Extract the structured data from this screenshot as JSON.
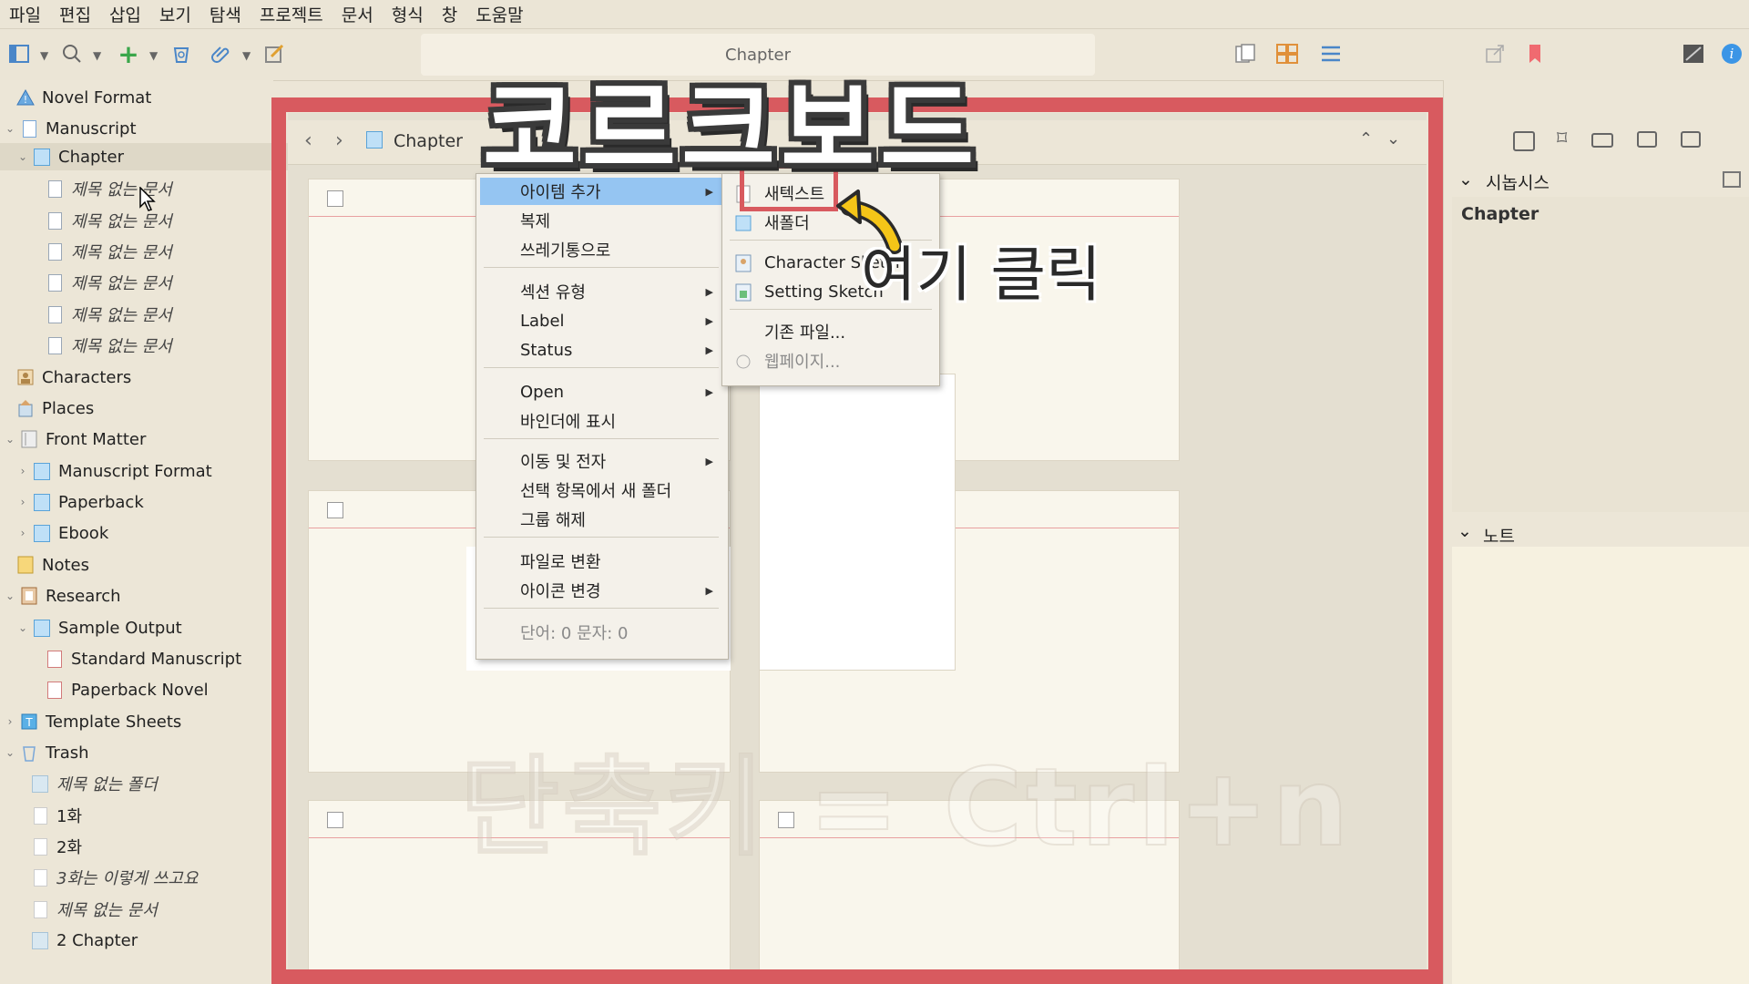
{
  "menubar": [
    "파일",
    "편집",
    "삽입",
    "보기",
    "탐색",
    "프로젝트",
    "문서",
    "형식",
    "창",
    "도움말"
  ],
  "toolbar": {
    "doc_title": "Chapter",
    "icons": [
      "binder-icon",
      "search-icon",
      "add-icon",
      "trash-icon",
      "attach-icon",
      "compose-icon",
      "single-view-icon",
      "corkboard-icon",
      "outline-icon",
      "share-icon",
      "bookmark-icon",
      "compose-mode-icon",
      "info-icon"
    ]
  },
  "binder": {
    "items": [
      {
        "label": "Novel Format",
        "level": 0,
        "icon": "warning-icon"
      },
      {
        "label": "Manuscript",
        "level": 0,
        "icon": "document-icon"
      },
      {
        "label": "Chapter",
        "level": 1,
        "icon": "folder-icon"
      },
      {
        "label": "제목 없는 문서",
        "level": 2,
        "icon": "document-icon"
      },
      {
        "label": "제목 없는 문서",
        "level": 2,
        "icon": "document-icon"
      },
      {
        "label": "제목 없는 문서",
        "level": 2,
        "icon": "document-icon"
      },
      {
        "label": "제목 없는 문서",
        "level": 2,
        "icon": "document-icon"
      },
      {
        "label": "제목 없는 문서",
        "level": 2,
        "icon": "document-icon"
      },
      {
        "label": "제목 없는 문서",
        "level": 2,
        "icon": "document-icon"
      },
      {
        "label": "Characters",
        "level": 0,
        "icon": "characters-icon"
      },
      {
        "label": "Places",
        "level": 0,
        "icon": "places-icon"
      },
      {
        "label": "Front Matter",
        "level": 0,
        "icon": "front-matter-icon"
      },
      {
        "label": "Manuscript Format",
        "level": 1,
        "icon": "folder-icon"
      },
      {
        "label": "Paperback",
        "level": 1,
        "icon": "folder-icon"
      },
      {
        "label": "Ebook",
        "level": 1,
        "icon": "folder-icon"
      },
      {
        "label": "Notes",
        "level": 0,
        "icon": "notes-icon"
      },
      {
        "label": "Research",
        "level": 0,
        "icon": "research-icon"
      },
      {
        "label": "Sample Output",
        "level": 1,
        "icon": "folder-icon"
      },
      {
        "label": "Standard Manuscript",
        "level": 2,
        "icon": "pdf-icon"
      },
      {
        "label": "Paperback Novel",
        "level": 2,
        "icon": "pdf-icon"
      },
      {
        "label": "Template Sheets",
        "level": 0,
        "icon": "template-icon"
      },
      {
        "label": "Trash",
        "level": 0,
        "icon": "trash-icon"
      },
      {
        "label": "제목 없는 폴더",
        "level": 1,
        "icon": "folder-icon"
      },
      {
        "label": "1화",
        "level": 1,
        "icon": "document-icon"
      },
      {
        "label": "2화",
        "level": 1,
        "icon": "document-icon"
      },
      {
        "label": "3화는 이렇게 쓰고요",
        "level": 1,
        "icon": "document-icon"
      },
      {
        "label": "제목 없는 문서",
        "level": 1,
        "icon": "document-icon"
      },
      {
        "label": "2 Chapter",
        "level": 1,
        "icon": "document-icon"
      }
    ]
  },
  "editor": {
    "breadcrumb": "Chapter"
  },
  "context_menu": {
    "items": [
      {
        "label": "아이템 추가",
        "submenu": true,
        "highlighted": true
      },
      {
        "label": "복제"
      },
      {
        "label": "쓰레기통으로"
      },
      {
        "label": "섹션 유형",
        "submenu": true
      },
      {
        "label": "Label",
        "submenu": true
      },
      {
        "label": "Status",
        "submenu": true
      },
      {
        "label": "Open",
        "submenu": true
      },
      {
        "label": "바인더에 표시"
      },
      {
        "label": "이동 및 전자",
        "submenu": true
      },
      {
        "label": "선택 항목에서 새 폴더"
      },
      {
        "label": "그룹 해제"
      },
      {
        "label": "파일로 변환"
      },
      {
        "label": "아이콘 변경",
        "submenu": true
      },
      {
        "label": "단어: 0 문자: 0",
        "disabled": true
      }
    ]
  },
  "submenu": {
    "items": [
      {
        "label": "새텍스트"
      },
      {
        "label": "새폴더"
      },
      {
        "label": "Character Sketch"
      },
      {
        "label": "Setting Sketch"
      },
      {
        "label": "기존 파일..."
      },
      {
        "label": "웹페이지...",
        "disabled": true
      }
    ]
  },
  "inspector": {
    "synopsis_header": "시놉시스",
    "synopsis_title": "Chapter",
    "notes_header": "노트"
  },
  "overlay": {
    "title": "코르크보드",
    "click_hint": "여기 클릭",
    "shortcut": "단축키 = Ctrl+n"
  },
  "colors": {
    "frame": "#d85a5f",
    "highlight": "#95c5f2",
    "accent": "#4a86c8"
  }
}
